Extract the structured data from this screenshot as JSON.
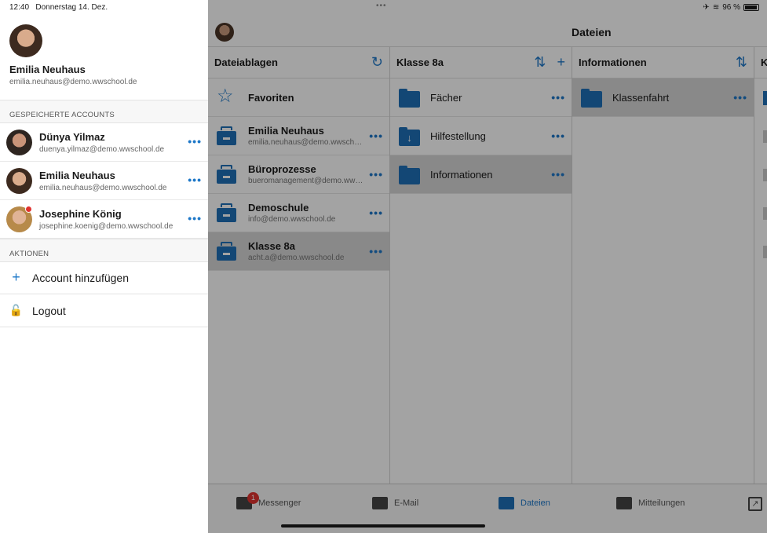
{
  "status_bar": {
    "time": "12:40",
    "date": "Donnerstag 14. Dez.",
    "battery": "96 %",
    "top_dots": "•••"
  },
  "app": {
    "title": "Dateien"
  },
  "columns": [
    {
      "title": "Dateiablagen",
      "icons": [
        "refresh-icon"
      ],
      "items": [
        {
          "name": "Favoriten",
          "sub": "",
          "icon": "star-icon",
          "more": false,
          "selected": false
        },
        {
          "name": "Emilia Neuhaus",
          "sub": "emilia.neuhaus@demo.wwschool.de",
          "icon": "cabinet-icon",
          "more": true,
          "selected": false
        },
        {
          "name": "Büroprozesse",
          "sub": "bueromanagement@demo.wwschool.de",
          "icon": "cabinet-icon",
          "more": true,
          "selected": false
        },
        {
          "name": "Demoschule",
          "sub": "info@demo.wwschool.de",
          "icon": "cabinet-icon",
          "more": true,
          "selected": false
        },
        {
          "name": "Klasse 8a",
          "sub": "acht.a@demo.wwschool.de",
          "icon": "cabinet-icon",
          "more": true,
          "selected": true
        }
      ]
    },
    {
      "title": "Klasse 8a",
      "icons": [
        "sort-icon",
        "plus-icon"
      ],
      "items": [
        {
          "name": "Fächer",
          "icon": "folder-icon",
          "more": true,
          "selected": false
        },
        {
          "name": "Hilfestellung",
          "icon": "download-folder-icon",
          "more": true,
          "selected": false
        },
        {
          "name": "Informationen",
          "icon": "folder-icon",
          "more": true,
          "selected": true
        }
      ]
    },
    {
      "title": "Informationen",
      "icons": [
        "sort-icon"
      ],
      "items": [
        {
          "name": "Klassenfahrt",
          "icon": "folder-icon",
          "more": true,
          "selected": true
        }
      ]
    },
    {
      "title": "K",
      "icons": [],
      "items": []
    }
  ],
  "tabs": [
    {
      "label": "Messenger",
      "icon": "chat-icon",
      "badge": "1",
      "active": false
    },
    {
      "label": "E-Mail",
      "icon": "mail-icon",
      "badge": "",
      "active": false
    },
    {
      "label": "Dateien",
      "icon": "cabinet-icon",
      "badge": "",
      "active": true
    },
    {
      "label": "Mitteilungen",
      "icon": "announcement-icon",
      "badge": "",
      "active": false
    }
  ],
  "panel": {
    "current_user": {
      "name": "Emilia Neuhaus",
      "email": "emilia.neuhaus@demo.wwschool.de"
    },
    "saved_header": "GESPEICHERTE ACCOUNTS",
    "accounts": [
      {
        "name": "Dünya Yilmaz",
        "email": "duenya.yilmaz@demo.wwschool.de",
        "notification": false
      },
      {
        "name": "Emilia Neuhaus",
        "email": "emilia.neuhaus@demo.wwschool.de",
        "notification": false
      },
      {
        "name": "Josephine König",
        "email": "josephine.koenig@demo.wwschool.de",
        "notification": true
      }
    ],
    "actions_header": "AKTIONEN",
    "actions": [
      {
        "label": "Account hinzufügen",
        "icon": "plus-icon"
      },
      {
        "label": "Logout",
        "icon": "lock-icon"
      }
    ]
  },
  "colors": {
    "accent": "#1e78c8",
    "folder": "#1e6fb7",
    "badge": "#e0322f"
  }
}
